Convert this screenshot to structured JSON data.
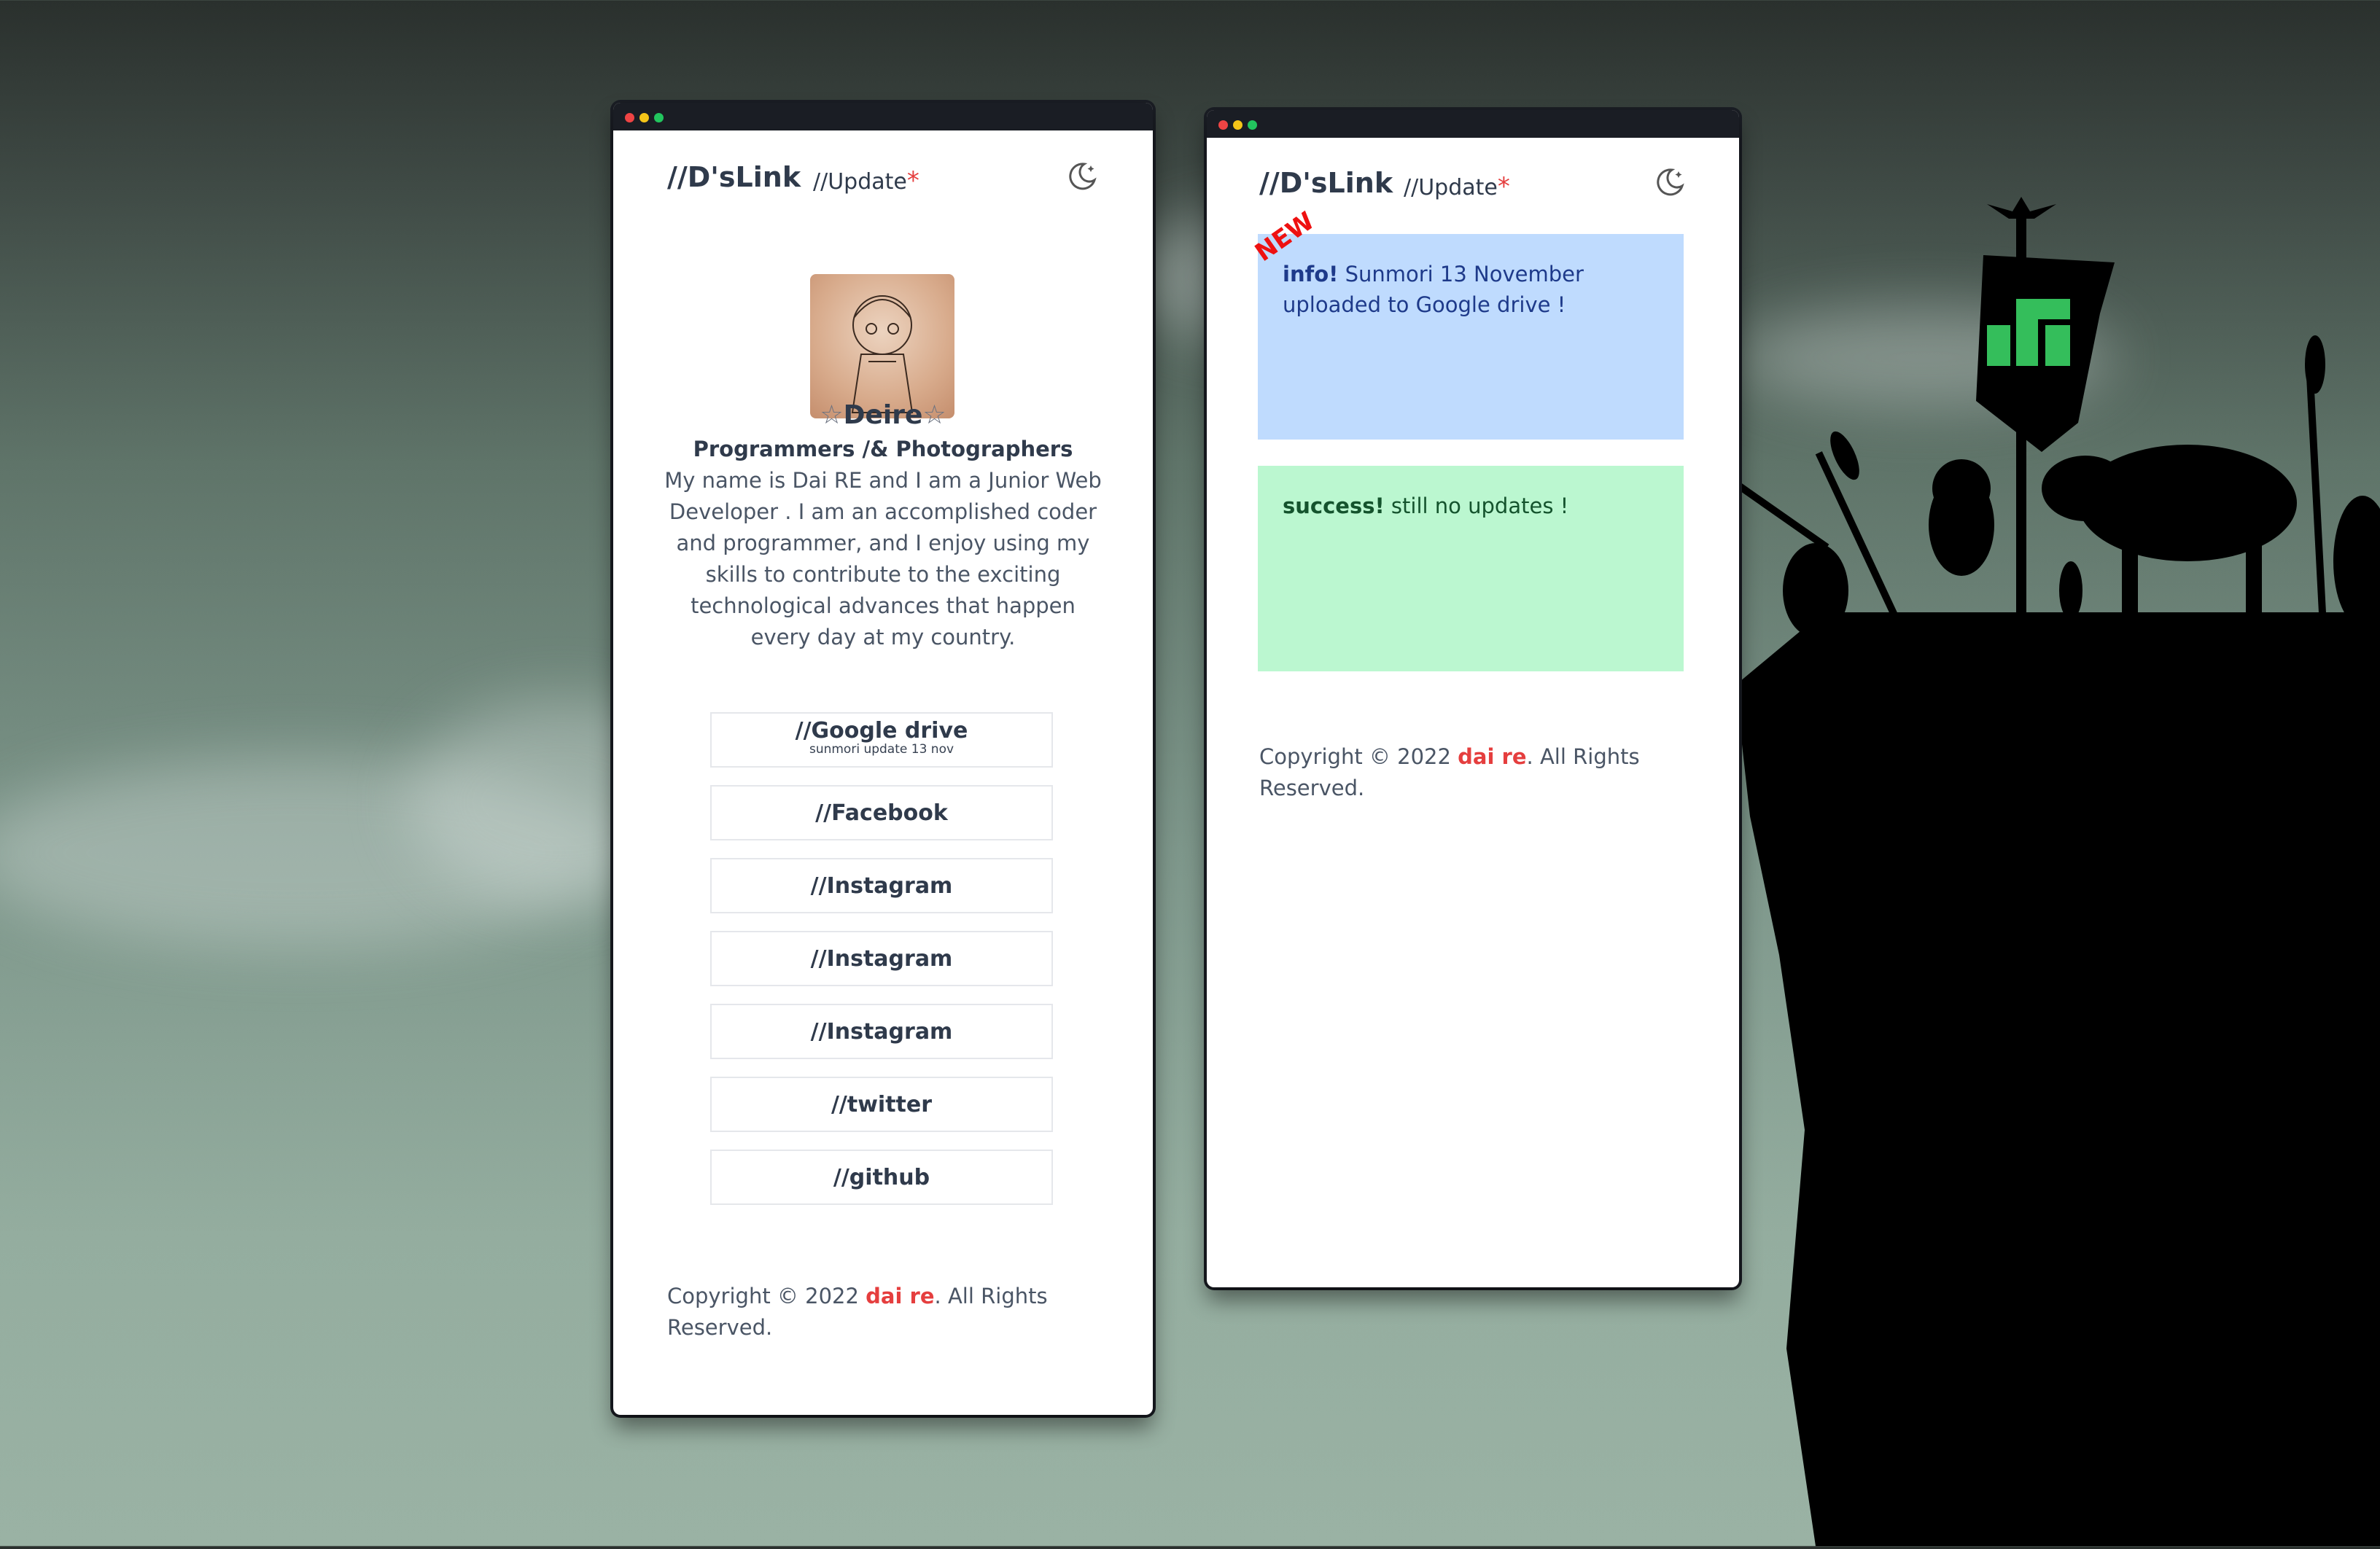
{
  "left_window": {
    "brand": "//D'sLink",
    "update_link": "//Update",
    "update_star": "*",
    "profile": {
      "name_prefix": "☆",
      "name": "Deire",
      "name_suffix": "☆",
      "role": "Programmers /& Photographers",
      "bio": "My name is Dai RE and I am a Junior Web Developer . I am an accomplished coder and programmer, and I enjoy using my skills to contribute to the exciting technological advances that happen every day at my country."
    },
    "links": [
      {
        "label": "//Google drive",
        "sub": "sunmori update 13 nov"
      },
      {
        "label": "//Facebook"
      },
      {
        "label": "//Instagram"
      },
      {
        "label": "//Instagram"
      },
      {
        "label": "//Instagram"
      },
      {
        "label": "//twitter"
      },
      {
        "label": "//github"
      }
    ],
    "footer": {
      "prefix": "Copyright © 2022 ",
      "name": "dai re",
      "suffix": ". All Rights Reserved."
    }
  },
  "right_window": {
    "brand": "//D'sLink",
    "update_link": "//Update",
    "update_star": "*",
    "new_tag": "NEW",
    "info_alert": {
      "title": "info!",
      "text": " Sunmori 13 November uploaded to Google drive !"
    },
    "success_alert": {
      "title": "success!",
      "text": " still no updates !"
    },
    "footer": {
      "prefix": "Copyright © 2022 ",
      "name": "dai re",
      "suffix": ". All Rights Reserved."
    }
  },
  "icons": {
    "theme_toggle": "moon-icon",
    "flag_logo": "manjaro-logo-icon"
  },
  "colors": {
    "accent_red": "#e53e3e",
    "info_bg": "#bfdbfe",
    "success_bg": "#bbf7d0",
    "text": "#2f3a4b"
  }
}
